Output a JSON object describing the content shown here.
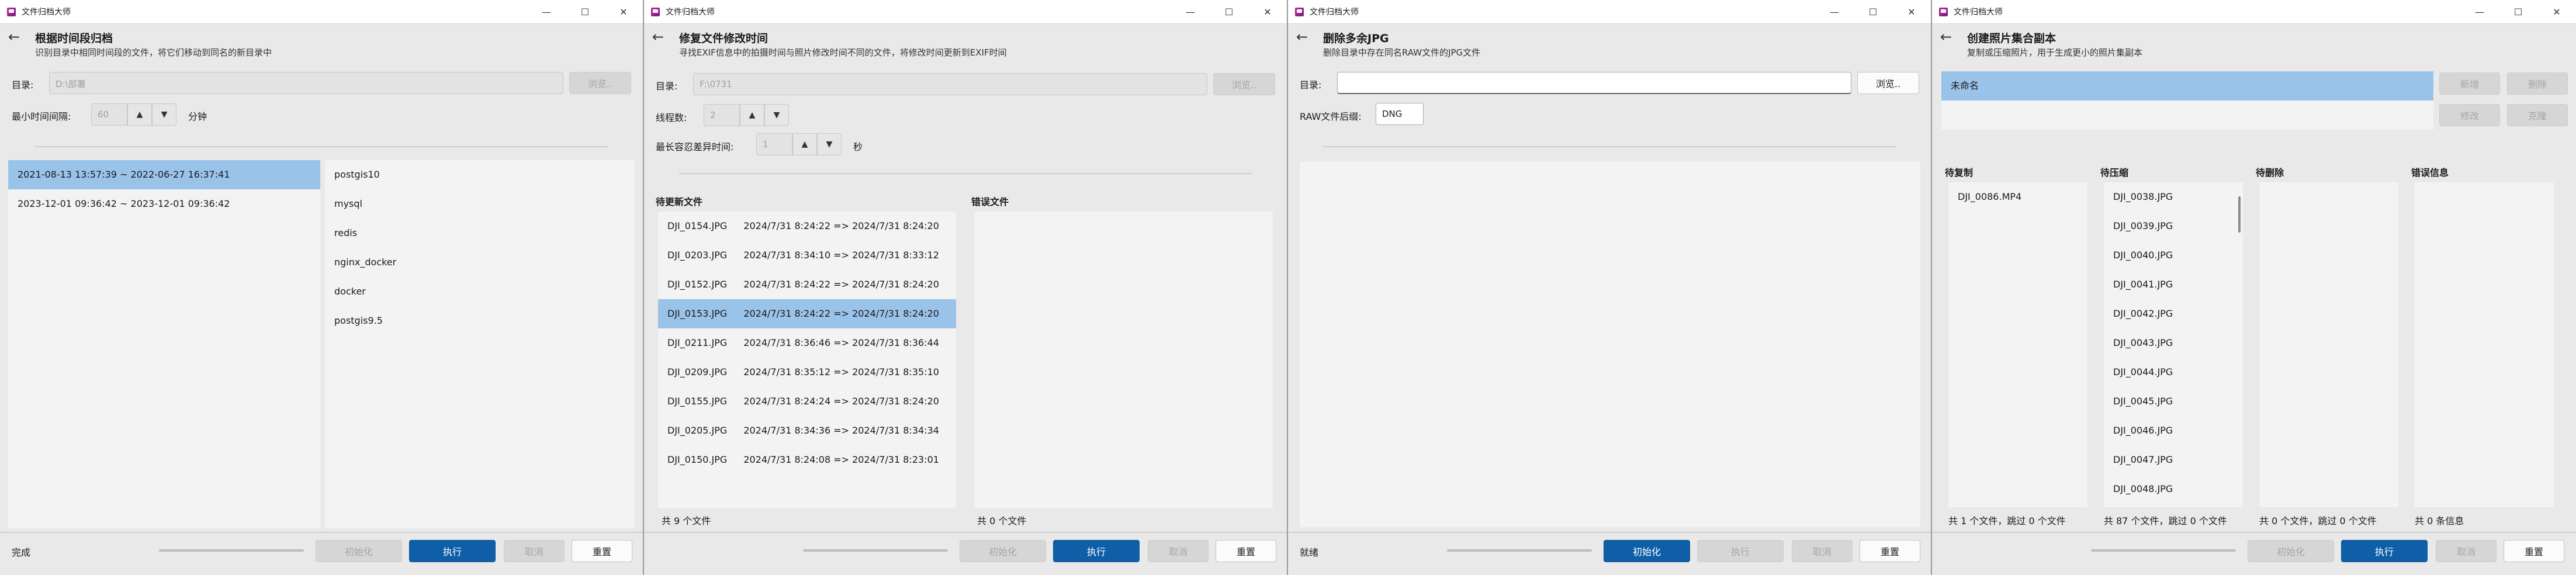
{
  "app_title": "文件归档大师",
  "window_controls": {
    "minimize": "—",
    "maximize": "☐",
    "close": "✕"
  },
  "back_glyph": "←",
  "windows": [
    {
      "title": "根据时间段归档",
      "subtitle": "识别目录中相同时间段的文件，将它们移动到同名的新目录中",
      "dir_label": "目录:",
      "dir_value": "D:\\部署",
      "browse": "浏览..",
      "min_interval_label": "最小时间间隔:",
      "min_interval_value": "60",
      "unit": "分钟",
      "periods": [
        "2021-08-13 13:57:39 ~ 2022-06-27 16:37:41",
        "2023-12-01 09:36:42 ~ 2023-12-01 09:36:42"
      ],
      "folders": [
        "postgis10",
        "mysql",
        "redis",
        "nginx_docker",
        "docker",
        "postgis9.5"
      ],
      "status": "完成",
      "buttons": {
        "init": "初始化",
        "run": "执行",
        "cancel": "取消",
        "reset": "重置"
      }
    },
    {
      "title": "修复文件修改时间",
      "subtitle": "寻找EXIF信息中的拍摄时间与照片修改时间不同的文件，将修改时间更新到EXIF时间",
      "dir_label": "目录:",
      "dir_value": "F:\\0731",
      "browse": "浏览..",
      "threads_label": "线程数:",
      "threads_value": "2",
      "tolerance_label": "最长容忍差异时间:",
      "tolerance_value": "1",
      "tolerance_unit": "秒",
      "pending_header": "待更新文件",
      "error_header": "错误文件",
      "files": [
        {
          "name": "DJI_0154.JPG",
          "change": "2024/7/31 8:24:22 => 2024/7/31 8:24:20"
        },
        {
          "name": "DJI_0203.JPG",
          "change": "2024/7/31 8:34:10 => 2024/7/31 8:33:12"
        },
        {
          "name": "DJI_0152.JPG",
          "change": "2024/7/31 8:24:22 => 2024/7/31 8:24:20"
        },
        {
          "name": "DJI_0153.JPG",
          "change": "2024/7/31 8:24:22 => 2024/7/31 8:24:20"
        },
        {
          "name": "DJI_0211.JPG",
          "change": "2024/7/31 8:36:46 => 2024/7/31 8:36:44"
        },
        {
          "name": "DJI_0209.JPG",
          "change": "2024/7/31 8:35:12 => 2024/7/31 8:35:10"
        },
        {
          "name": "DJI_0155.JPG",
          "change": "2024/7/31 8:24:24 => 2024/7/31 8:24:20"
        },
        {
          "name": "DJI_0205.JPG",
          "change": "2024/7/31 8:34:36 => 2024/7/31 8:34:34"
        },
        {
          "name": "DJI_0150.JPG",
          "change": "2024/7/31 8:24:08 => 2024/7/31 8:23:01"
        }
      ],
      "pending_count": "共 9 个文件",
      "error_count": "共 0 个文件",
      "buttons": {
        "init": "初始化",
        "run": "执行",
        "cancel": "取消",
        "reset": "重置"
      }
    },
    {
      "title": "删除多余JPG",
      "subtitle": "删除目录中存在同名RAW文件的JPG文件",
      "dir_label": "目录:",
      "dir_value": "",
      "browse": "浏览..",
      "raw_label": "RAW文件后缀:",
      "raw_value": "DNG",
      "status": "就绪",
      "buttons": {
        "init": "初始化",
        "run": "执行",
        "cancel": "取消",
        "reset": "重置"
      }
    },
    {
      "title": "创建照片集合副本",
      "subtitle": "复制或压缩照片，用于生成更小的照片集副本",
      "collection": "未命名",
      "side_buttons": {
        "add": "新增",
        "delete": "删除",
        "edit": "修改",
        "clone": "克隆"
      },
      "col_copy": "待复制",
      "col_compress": "待压缩",
      "col_delete": "待删除",
      "col_error": "错误信息",
      "copy_files": [
        "DJI_0086.MP4"
      ],
      "compress_files": [
        "DJI_0038.JPG",
        "DJI_0039.JPG",
        "DJI_0040.JPG",
        "DJI_0041.JPG",
        "DJI_0042.JPG",
        "DJI_0043.JPG",
        "DJI_0044.JPG",
        "DJI_0045.JPG",
        "DJI_0046.JPG",
        "DJI_0047.JPG",
        "DJI_0048.JPG"
      ],
      "copy_count": "共 1 个文件，跳过 0 个文件",
      "compress_count": "共 87 个文件，跳过 0 个文件",
      "delete_count": "共 0 个文件，跳过 0 个文件",
      "error_count": "共 0 条信息",
      "buttons": {
        "init": "初始化",
        "run": "执行",
        "cancel": "取消",
        "reset": "重置"
      }
    }
  ]
}
